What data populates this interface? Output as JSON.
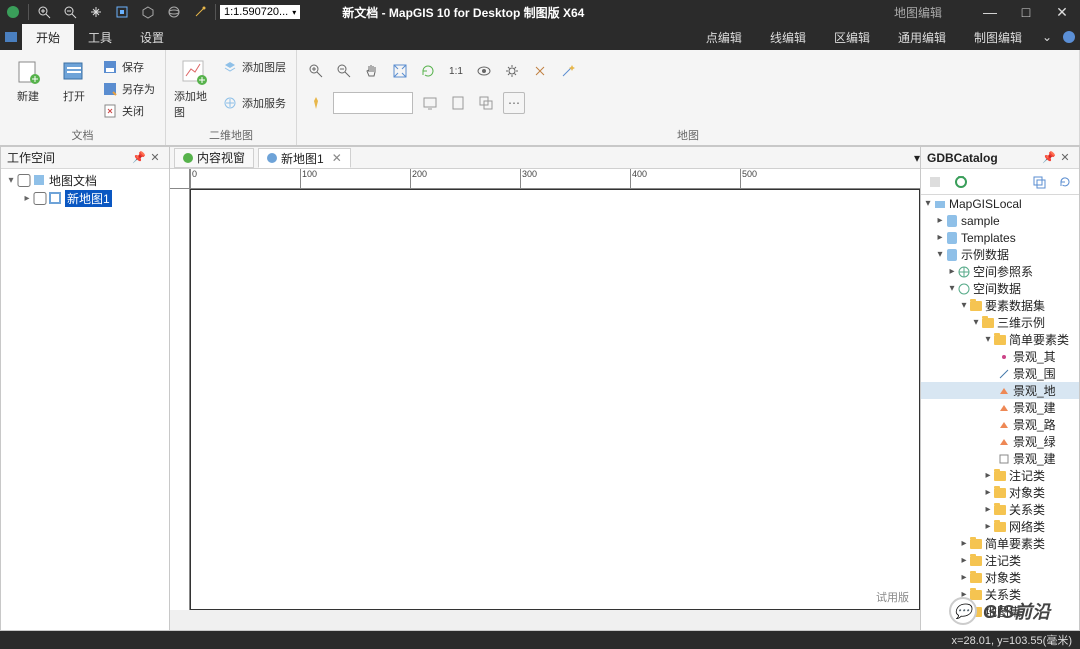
{
  "titlebar": {
    "scale": "1:1.590720...",
    "title": "新文档 - MapGIS 10 for Desktop 制图版 X64",
    "context": "地图编辑"
  },
  "menu": {
    "left": [
      "开始",
      "工具",
      "设置"
    ],
    "right": [
      "点编辑",
      "线编辑",
      "区编辑",
      "通用编辑",
      "制图编辑"
    ]
  },
  "ribbon": {
    "doc_group": "文档",
    "new": "新建",
    "open": "打开",
    "save": "保存",
    "saveas": "另存为",
    "close": "关闭",
    "map2d_group": "二维地图",
    "addmap": "添加地图",
    "addlayer": "添加图层",
    "addservice": "添加服务",
    "ratio": "1:1",
    "map_group": "地图"
  },
  "workspace": {
    "title": "工作空间",
    "root": "地图文档",
    "child": "新地图1"
  },
  "tabs": {
    "content": "内容视窗",
    "map": "新地图1"
  },
  "ruler_ticks": [
    "0",
    "100",
    "200",
    "300",
    "400",
    "500"
  ],
  "canvas": {
    "trial": "试用版"
  },
  "gdb": {
    "title": "GDBCatalog",
    "tree": {
      "root": "MapGISLocal",
      "sample": "sample",
      "templates": "Templates",
      "demo": "示例数据",
      "srs": "空间参照系",
      "spatial": "空间数据",
      "featureset": "要素数据集",
      "example3d": "三维示例",
      "simplefc": "简单要素类",
      "items": [
        "景观_其",
        "景观_围",
        "景观_地",
        "景观_建",
        "景观_路",
        "景观_绿",
        "景观_建"
      ],
      "anno": "注记类",
      "obj": "对象类",
      "rel": "关系类",
      "net": "网络类",
      "simplefc2": "简单要素类",
      "anno2": "注记类",
      "obj2": "对象类",
      "rel2": "关系类",
      "mapset": "地图集"
    }
  },
  "status": "x=28.01, y=103.55(毫米)",
  "watermark": "GIS前沿"
}
